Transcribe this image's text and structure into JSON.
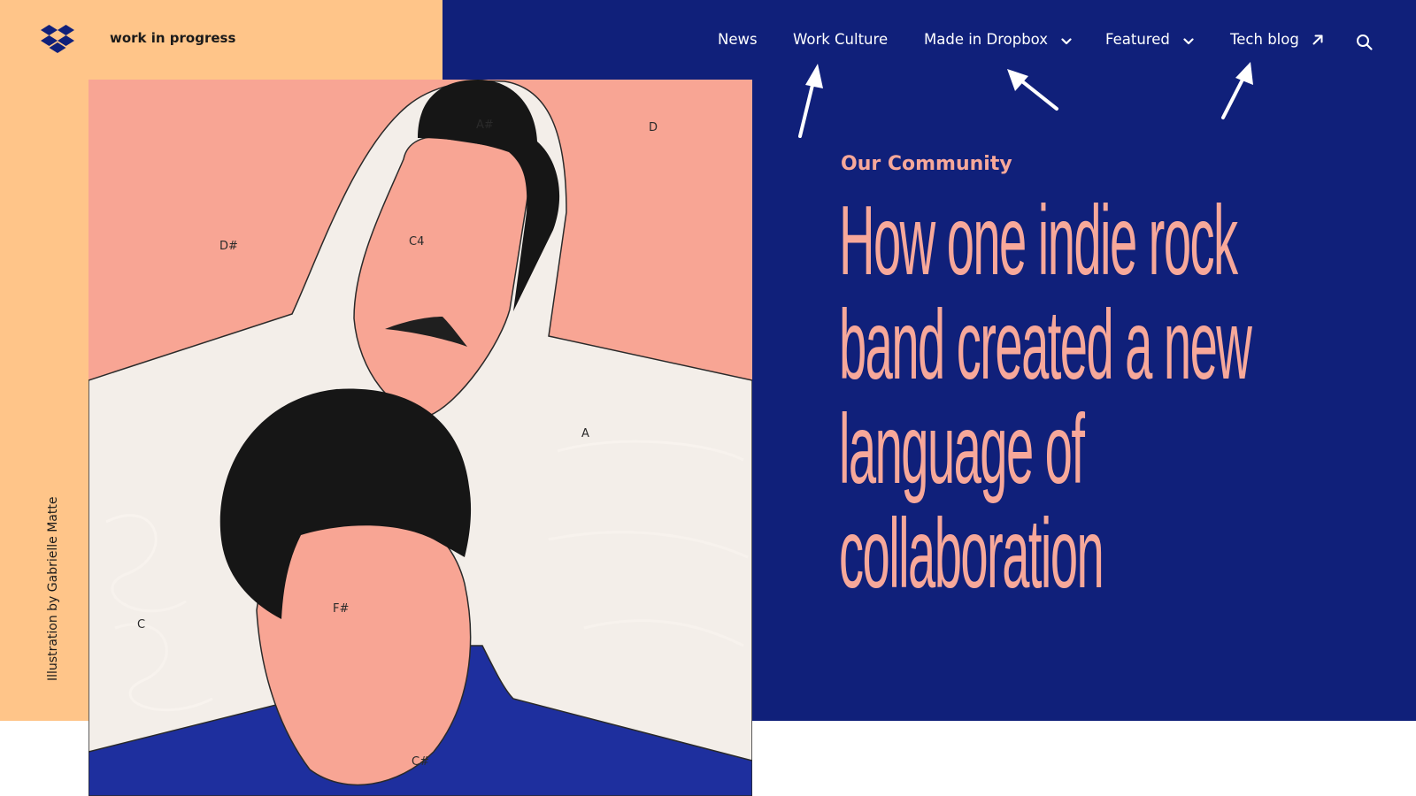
{
  "site": {
    "brand_name": "work in progress",
    "logo": "dropbox-logo-icon"
  },
  "nav": {
    "items": [
      {
        "label": "News"
      },
      {
        "label": "Work Culture"
      },
      {
        "label": "Made in Dropbox",
        "icon": "chevron-down-icon"
      },
      {
        "label": "Featured",
        "icon": "chevron-down-icon"
      },
      {
        "label": "Tech blog",
        "icon": "external-arrow-icon"
      }
    ],
    "search_icon": "search-icon"
  },
  "hero": {
    "category": "Our Community",
    "headline_lines": [
      "How one indie rock",
      "band created a new",
      "language of",
      "collaboration"
    ],
    "illustration_credit": "Illustration by Gabrielle Matte",
    "note_labels": [
      "A#",
      "D",
      "D#",
      "C4",
      "A",
      "C",
      "F#",
      "C#"
    ]
  },
  "colors": {
    "peach": "#ffc589",
    "navy": "#10207a",
    "salmon": "#f7a89a",
    "ink": "#1a1a1a"
  }
}
